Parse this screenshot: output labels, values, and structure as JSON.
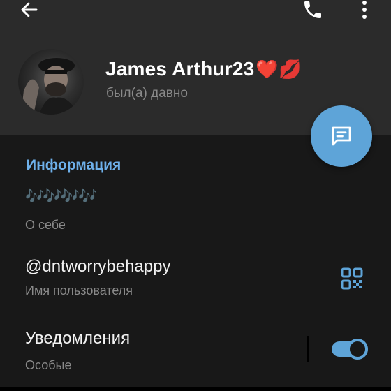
{
  "header": {
    "name": "James Arthur23",
    "name_emoji": "❤️💋",
    "status": "был(а) давно"
  },
  "icons": {
    "back": "arrow-left-icon",
    "call": "phone-icon",
    "more": "more-vertical-icon",
    "message": "message-icon",
    "qr": "qr-code-icon"
  },
  "info": {
    "section_title": "Информация",
    "bio": "🎶🎶🎶🎶",
    "bio_label": "О себе",
    "username": "@dntworrybehappy",
    "username_label": "Имя пользователя"
  },
  "notifications": {
    "title": "Уведомления",
    "subtitle": "Особые",
    "enabled": true
  },
  "colors": {
    "accent": "#5ea4d8",
    "section_title": "#6eb0ea",
    "header_bg": "#2b2b2b",
    "page_bg": "#181818"
  }
}
